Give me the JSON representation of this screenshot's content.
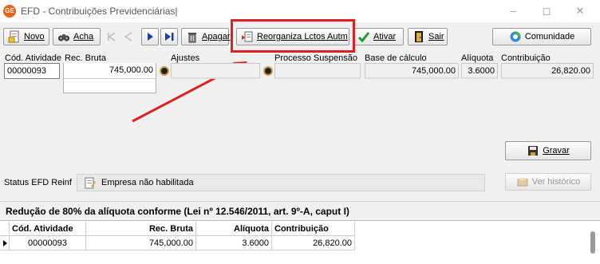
{
  "window": {
    "title": "EFD - Contribuições Previdenciárias|",
    "app_badge": "GE"
  },
  "toolbar": {
    "novo": "Novo",
    "acha": "Acha",
    "apagar": "Apagar",
    "reorganiza": "Reorganiza Lctos Autm",
    "ativar": "Ativar",
    "sair": "Sair",
    "comunidade": "Comunidade"
  },
  "fields": {
    "cod_atividade": {
      "label": "Cód. Atividade",
      "value": "00000093"
    },
    "rec_bruta": {
      "label": "Rec. Bruta",
      "value": "745,000.00"
    },
    "ajustes": {
      "label": "Ajustes",
      "value": ""
    },
    "processo_suspensao": {
      "label": "Processo Suspensão",
      "value": ""
    },
    "base_calculo": {
      "label": "Base de cálculo",
      "value": "745,000.00"
    },
    "aliquota": {
      "label": "Alíquota",
      "value": "3.6000"
    },
    "contribuicao": {
      "label": "Contribuição",
      "value": "26,820.00"
    }
  },
  "actions": {
    "gravar": "Gravar",
    "ver_historico": "Ver histórico"
  },
  "status": {
    "label": "Status EFD Reinf",
    "value": "Empresa não habilitada"
  },
  "section": {
    "title": "Redução de 80% da alíquota conforme (Lei nº 12.546/2011, art. 9º-A, caput I)"
  },
  "grid": {
    "headers": [
      "Cód. Atividade",
      "Rec. Bruta",
      "Alíquota",
      "Contribuição"
    ],
    "rows": [
      [
        "00000093",
        "745,000.00",
        "3.6000",
        "26,820.00"
      ]
    ]
  },
  "colors": {
    "highlight": "#e02020",
    "app_icon": "#e8641b"
  }
}
